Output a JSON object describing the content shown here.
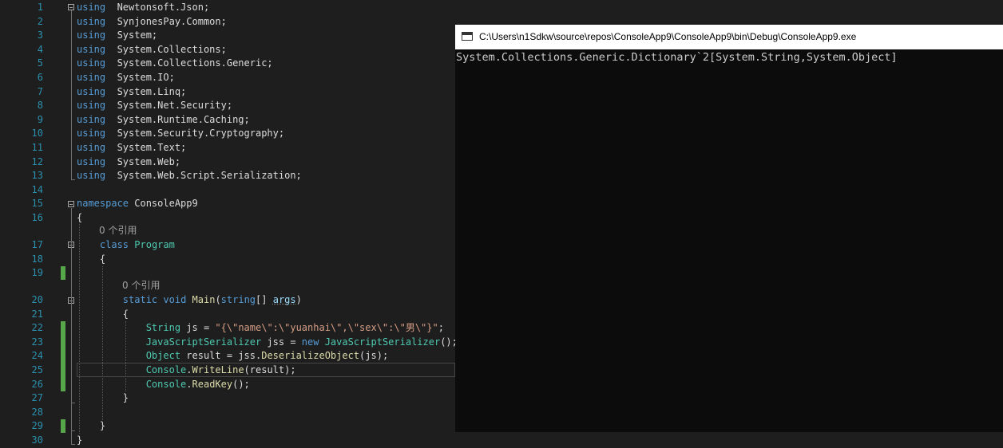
{
  "editor": {
    "lines": [
      {
        "n": "1",
        "t": [
          [
            "kw",
            "using"
          ],
          [
            "",
            "  Newtonsoft.Json;"
          ]
        ]
      },
      {
        "n": "2",
        "t": [
          [
            "kw",
            "using"
          ],
          [
            "",
            "  SynjonesPay.Common;"
          ]
        ]
      },
      {
        "n": "3",
        "t": [
          [
            "kw",
            "using"
          ],
          [
            "",
            "  System;"
          ]
        ]
      },
      {
        "n": "4",
        "t": [
          [
            "kw",
            "using"
          ],
          [
            "",
            "  System.Collections;"
          ]
        ]
      },
      {
        "n": "5",
        "t": [
          [
            "kw",
            "using"
          ],
          [
            "",
            "  System.Collections.Generic;"
          ]
        ]
      },
      {
        "n": "6",
        "t": [
          [
            "kw",
            "using"
          ],
          [
            "",
            "  System.IO;"
          ]
        ]
      },
      {
        "n": "7",
        "t": [
          [
            "kw",
            "using"
          ],
          [
            "",
            "  System.Linq;"
          ]
        ]
      },
      {
        "n": "8",
        "t": [
          [
            "kw",
            "using"
          ],
          [
            "",
            "  System.Net.Security;"
          ]
        ]
      },
      {
        "n": "9",
        "t": [
          [
            "kw",
            "using"
          ],
          [
            "",
            "  System.Runtime.Caching;"
          ]
        ]
      },
      {
        "n": "10",
        "t": [
          [
            "kw",
            "using"
          ],
          [
            "",
            "  System.Security.Cryptography;"
          ]
        ]
      },
      {
        "n": "11",
        "t": [
          [
            "kw",
            "using"
          ],
          [
            "",
            "  System.Text;"
          ]
        ]
      },
      {
        "n": "12",
        "t": [
          [
            "kw",
            "using"
          ],
          [
            "",
            "  System.Web;"
          ]
        ]
      },
      {
        "n": "13",
        "t": [
          [
            "kw",
            "using"
          ],
          [
            "",
            "  System.Web.Script.Serialization;"
          ]
        ]
      },
      {
        "n": "14",
        "t": []
      },
      {
        "n": "15",
        "t": [
          [
            "kw",
            "namespace"
          ],
          [
            "",
            " ConsoleApp9"
          ]
        ]
      },
      {
        "n": "16",
        "t": [
          [
            "",
            "{"
          ]
        ]
      },
      {
        "n": "17",
        "t": [
          [
            "",
            "    "
          ],
          [
            "kw",
            "class"
          ],
          [
            "",
            " "
          ],
          [
            "ty",
            "Program"
          ]
        ]
      },
      {
        "n": "18",
        "t": [
          [
            "",
            "    {"
          ]
        ]
      },
      {
        "n": "19",
        "t": []
      },
      {
        "n": "20",
        "t": [
          [
            "",
            "        "
          ],
          [
            "kw",
            "static"
          ],
          [
            "",
            " "
          ],
          [
            "kw",
            "void"
          ],
          [
            "",
            " "
          ],
          [
            "mt",
            "Main"
          ],
          [
            "",
            "("
          ],
          [
            "kw",
            "string"
          ],
          [
            "",
            "[] "
          ],
          [
            "pm",
            "args"
          ],
          [
            "",
            ")"
          ]
        ]
      },
      {
        "n": "21",
        "t": [
          [
            "",
            "        {"
          ]
        ]
      },
      {
        "n": "22",
        "t": [
          [
            "",
            "            "
          ],
          [
            "ty",
            "String"
          ],
          [
            "",
            " js = "
          ],
          [
            "str",
            "\"{\\\"name\\\":\\\"yuanhai\\\",\\\"sex\\\":\\\"男\\\"}\""
          ],
          [
            "",
            ";"
          ]
        ]
      },
      {
        "n": "23",
        "t": [
          [
            "",
            "            "
          ],
          [
            "ty",
            "JavaScriptSerializer"
          ],
          [
            "",
            " jss = "
          ],
          [
            "kw",
            "new"
          ],
          [
            "",
            " "
          ],
          [
            "ty",
            "JavaScriptSerializer"
          ],
          [
            "",
            "();"
          ]
        ]
      },
      {
        "n": "24",
        "t": [
          [
            "",
            "            "
          ],
          [
            "ty",
            "Object"
          ],
          [
            "",
            " result = jss."
          ],
          [
            "mt",
            "DeserializeObject"
          ],
          [
            "",
            "(js);"
          ]
        ]
      },
      {
        "n": "25",
        "t": [
          [
            "",
            "            "
          ],
          [
            "ty",
            "Console"
          ],
          [
            "",
            "."
          ],
          [
            "mt",
            "WriteLine"
          ],
          [
            "",
            "(result);"
          ]
        ]
      },
      {
        "n": "26",
        "t": [
          [
            "",
            "            "
          ],
          [
            "ty",
            "Console"
          ],
          [
            "",
            "."
          ],
          [
            "mt",
            "ReadKey"
          ],
          [
            "",
            "();"
          ]
        ]
      },
      {
        "n": "27",
        "t": [
          [
            "",
            "        }"
          ]
        ]
      },
      {
        "n": "28",
        "t": []
      },
      {
        "n": "29",
        "t": [
          [
            "",
            "    }"
          ]
        ]
      },
      {
        "n": "30",
        "t": [
          [
            "",
            "}"
          ]
        ]
      }
    ],
    "codelens": [
      {
        "text": "0 个引用"
      },
      {
        "text": "0 个引用"
      }
    ]
  },
  "console": {
    "title": "C:\\Users\\n1Sdkw\\source\\repos\\ConsoleApp9\\ConsoleApp9\\bin\\Debug\\ConsoleApp9.exe",
    "output": "System.Collections.Generic.Dictionary`2[System.String,System.Object]",
    "icon": "console-app-icon"
  },
  "colors": {
    "editor_bg": "#1e1e1e",
    "keyword": "#569cd6",
    "type": "#4ec9b0",
    "string": "#d69d85",
    "method": "#dcdcaa",
    "line_number": "#2b91af",
    "change_marker": "#57a64a",
    "console_bg": "#0c0c0c",
    "console_text": "#cccccc"
  }
}
